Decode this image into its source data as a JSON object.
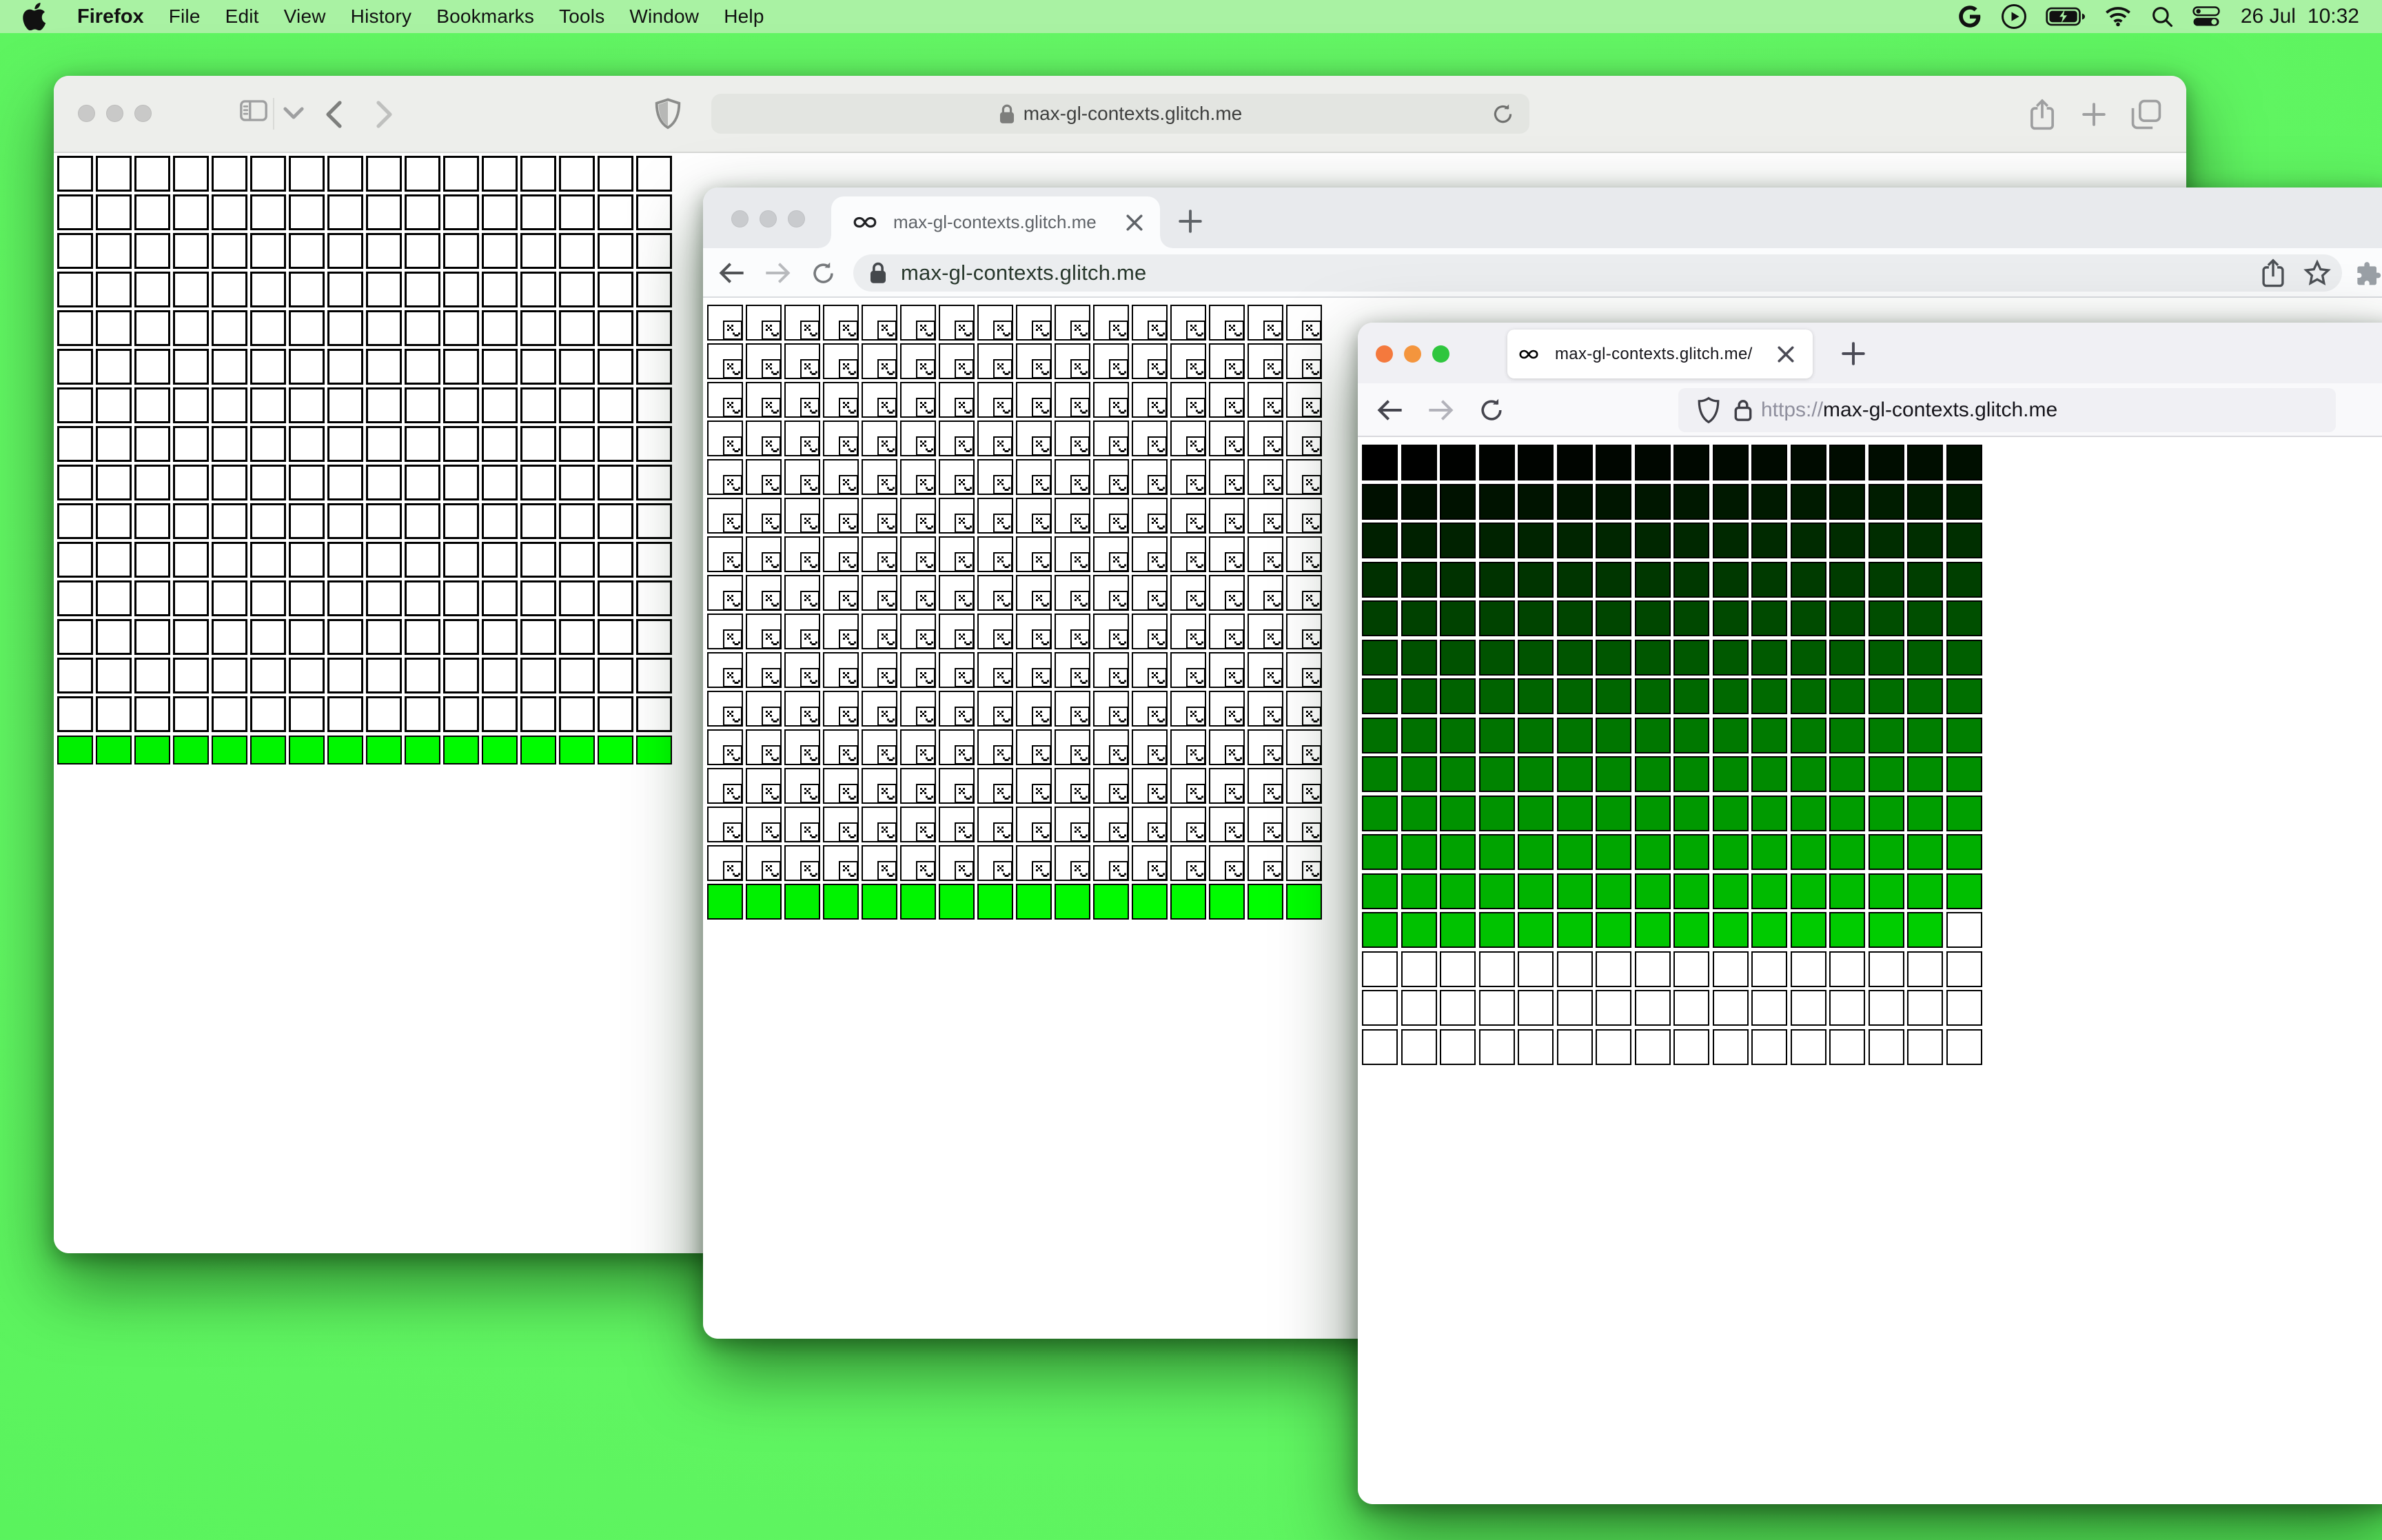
{
  "menu_bar": {
    "app_name": "Firefox",
    "menus": [
      "File",
      "Edit",
      "View",
      "History",
      "Bookmarks",
      "Tools",
      "Window",
      "Help"
    ],
    "status_icon_names": [
      "google-g-icon",
      "play-circle-icon",
      "battery-charging-icon",
      "wifi-icon",
      "search-icon",
      "control-center-icon"
    ],
    "date": "26 Jul",
    "time": "10:32"
  },
  "colors": {
    "desktop_green": "#5df45f",
    "menu_bar_green": "#a9f2a3",
    "live_canvas_green_formula": "rgb(0, index, 0)",
    "firefox_traffic_lights": [
      "#f4793d",
      "#f4953d",
      "#2fc63e"
    ],
    "inactive_traffic_light": "#c9cbce"
  },
  "site": {
    "domain": "max-gl-contexts.glitch.me"
  },
  "safari_window": {
    "browser": "Safari",
    "active": false,
    "url_field_text": "max-gl-contexts.glitch.me",
    "grid": {
      "columns": 16,
      "rows": 16,
      "cells_total": 256,
      "lost_style": "blank",
      "first_live_index": 240,
      "live_cells": 16,
      "live_color_formula": "rgb(0, index, 0)"
    }
  },
  "chrome_window": {
    "browser": "Chrome",
    "active": false,
    "tab_title": "max-gl-contexts.glitch.me",
    "url_field_text": "max-gl-contexts.glitch.me",
    "grid": {
      "columns": 16,
      "rows": 16,
      "cells_total": 256,
      "lost_style": "sad-face",
      "first_live_index": 240,
      "live_cells": 16,
      "live_color_formula": "rgb(0, index, 0)"
    }
  },
  "firefox_window": {
    "browser": "Firefox",
    "active": true,
    "tab_title": "max-gl-contexts.glitch.me/",
    "url_scheme": "https://",
    "url_host": "max-gl-contexts.glitch.me",
    "grid": {
      "columns": 16,
      "rows": 16,
      "cells_total": 256,
      "colored_cells": 207,
      "last_colored_index": 206,
      "blank_cells": 49,
      "color_formula": "rgb(0, index, 0)"
    }
  }
}
